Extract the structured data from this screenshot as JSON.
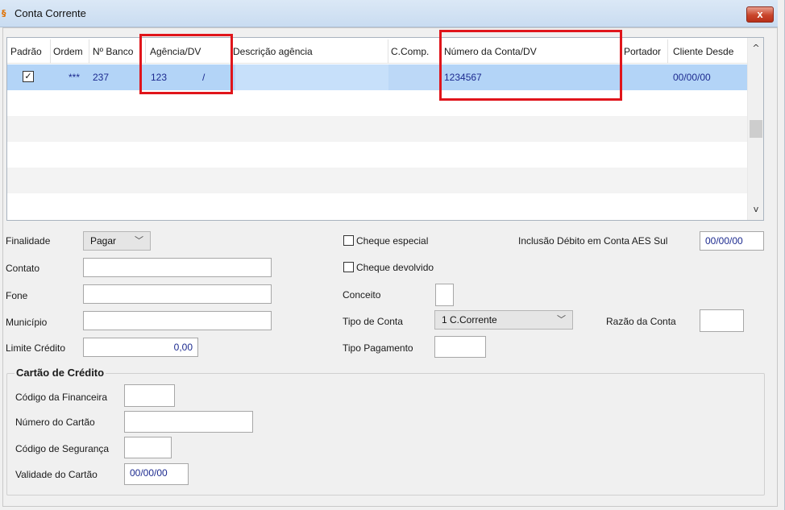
{
  "window": {
    "title": "Conta Corrente",
    "close_label": "x"
  },
  "grid": {
    "columns": [
      "Padrão",
      "Ordem",
      "Nº Banco",
      "Agência/DV",
      "Descrição agência",
      "C.Comp.",
      "Número da Conta/DV",
      "Portador",
      "Cliente Desde"
    ],
    "rows": [
      {
        "padrao": "✓",
        "ordem": "***",
        "banco": "237",
        "agencia": "123",
        "agencia_dv": "/",
        "descricao": "",
        "ccomp": "",
        "conta": "1234567",
        "portador": "",
        "cliente_desde": "00/00/00"
      }
    ],
    "scroll_up": "^",
    "scroll_down": "v"
  },
  "form": {
    "finalidade_label": "Finalidade",
    "finalidade_value": "Pagar",
    "contato_label": "Contato",
    "contato_value": "",
    "fone_label": "Fone",
    "fone_value": "",
    "municipio_label": "Município",
    "municipio_value": "",
    "limite_label": "Limite Crédito",
    "limite_value": "0,00",
    "cheque_especial_label": "Cheque especial",
    "cheque_devolvido_label": "Cheque devolvido",
    "conceito_label": "Conceito",
    "conceito_value": "",
    "tipo_conta_label": "Tipo de Conta",
    "tipo_conta_value": "1 C.Corrente",
    "tipo_pagamento_label": "Tipo Pagamento",
    "tipo_pagamento_value": "",
    "inclusao_label": "Inclusão Débito em Conta AES Sul",
    "inclusao_value": "00/00/00",
    "razao_label": "Razão da Conta",
    "razao_value": ""
  },
  "cartao": {
    "title": "Cartão de Crédito",
    "financeira_label": "Código da Financeira",
    "financeira_value": "",
    "numero_label": "Número do Cartão",
    "numero_value": "",
    "seguranca_label": "Código de Segurança",
    "seguranca_value": "",
    "validade_label": "Validade do Cartão",
    "validade_value": "00/00/00"
  },
  "colors": {
    "highlight": "#e0151b",
    "selection": "#b3d4f7",
    "value_text": "#1c2a8f"
  }
}
